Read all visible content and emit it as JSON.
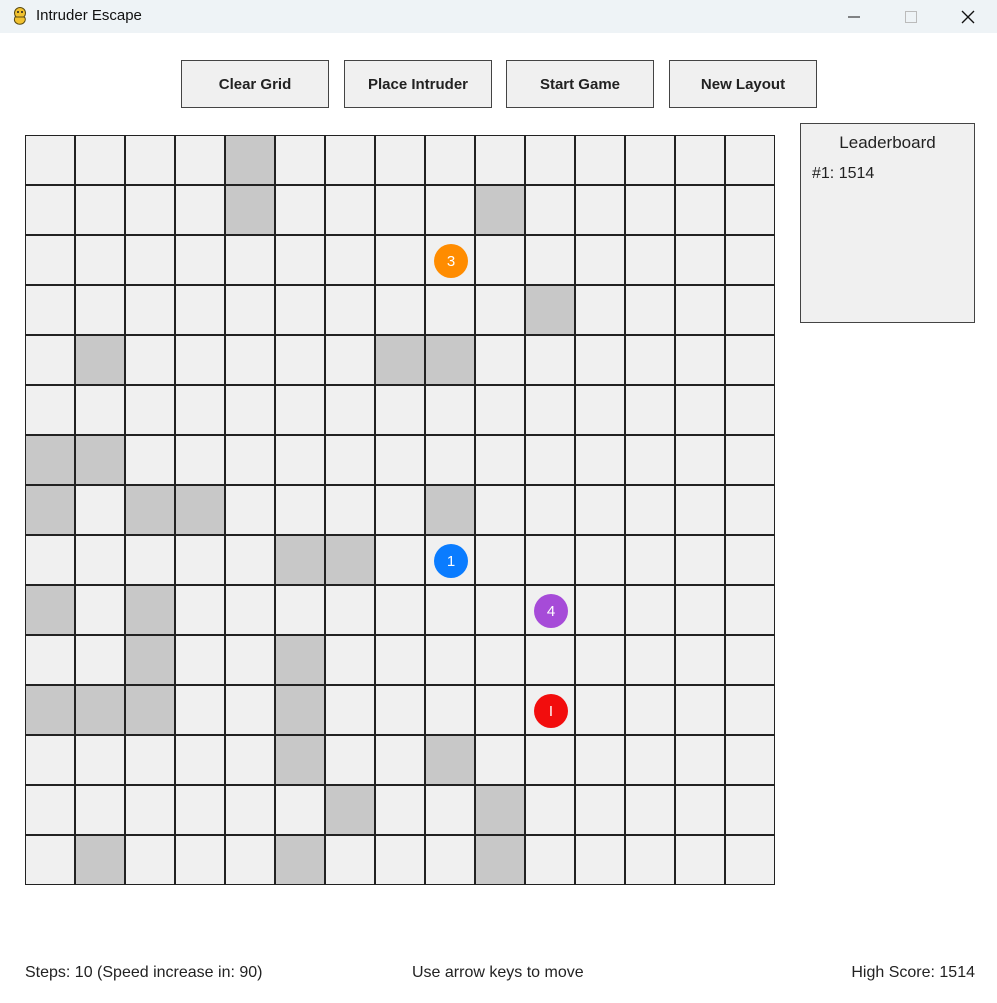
{
  "window": {
    "title": "Intruder Escape",
    "app_icon": "pygame-snake-icon",
    "controls": [
      "minimize-icon",
      "maximize-icon",
      "close-icon"
    ]
  },
  "toolbar": {
    "clear_grid": "Clear Grid",
    "place_intruder": "Place Intruder",
    "start_game": "Start Game",
    "new_layout": "New Layout"
  },
  "grid": {
    "rows": 15,
    "cols": 15,
    "colors": {
      "empty": "#f0f0f0",
      "wall": "#c8c8c8",
      "border": "#222222"
    },
    "walls": [
      [
        0,
        4
      ],
      [
        1,
        4
      ],
      [
        1,
        9
      ],
      [
        3,
        10
      ],
      [
        4,
        1
      ],
      [
        4,
        7
      ],
      [
        4,
        8
      ],
      [
        6,
        0
      ],
      [
        6,
        1
      ],
      [
        7,
        0
      ],
      [
        7,
        2
      ],
      [
        7,
        3
      ],
      [
        7,
        8
      ],
      [
        8,
        5
      ],
      [
        8,
        6
      ],
      [
        9,
        0
      ],
      [
        9,
        2
      ],
      [
        10,
        2
      ],
      [
        10,
        5
      ],
      [
        11,
        0
      ],
      [
        11,
        1
      ],
      [
        11,
        2
      ],
      [
        11,
        5
      ],
      [
        12,
        5
      ],
      [
        12,
        8
      ],
      [
        13,
        6
      ],
      [
        13,
        9
      ],
      [
        14,
        1
      ],
      [
        14,
        5
      ],
      [
        14,
        9
      ]
    ],
    "tokens": [
      {
        "label": "3",
        "row": 2,
        "col": 8,
        "color": "#ff8c00",
        "name": "enemy-3"
      },
      {
        "label": "1",
        "row": 8,
        "col": 8,
        "color": "#0a7cff",
        "name": "enemy-1"
      },
      {
        "label": "4",
        "row": 9,
        "col": 10,
        "color": "#a64bd8",
        "name": "enemy-4"
      },
      {
        "label": "I",
        "row": 11,
        "col": 10,
        "color": "#f20d0d",
        "name": "intruder"
      }
    ]
  },
  "leaderboard": {
    "title": "Leaderboard",
    "entries": [
      "#1: 1514"
    ]
  },
  "status": {
    "steps": "Steps: 10 (Speed increase in: 90)",
    "hint": "Use arrow keys to move",
    "high_score": "High Score: 1514"
  }
}
